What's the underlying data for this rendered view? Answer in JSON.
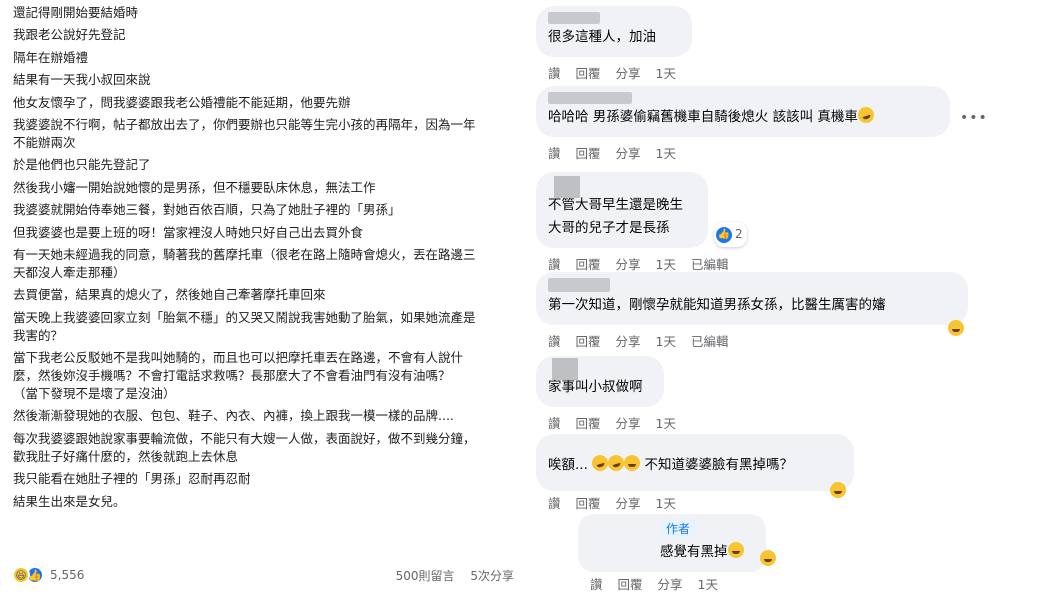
{
  "post": {
    "lines": [
      "還記得剛開始要結婚時",
      "我跟老公說好先登記",
      "隔年在辦婚禮",
      "結果有一天我小叔回來說",
      "他女友懷孕了，問我婆婆跟我老公婚禮能不能延期，他要先辦",
      "我婆婆說不行啊，帖子都放出去了，你們要辦也只能等生完小孩的再隔年，因為一年",
      "不能辦兩次",
      "於是他們也只能先登記了",
      "然後我小嬸一開始說她懷的是男孫，但不穩要臥床休息，無法工作",
      "我婆婆就開始侍奉她三餐，對她百依百順，只為了她肚子裡的「男孫」",
      "但我婆婆也是要上班的呀！當家裡沒人時她只好自己出去買外食",
      "有一天她未經過我的同意，騎著我的舊摩托車（很老在路上隨時會熄火，丟在路邊三",
      "天都沒人牽走那種）",
      "去買便當，結果真的熄火了，然後她自己牽著摩托車回來",
      "當天晚上我婆婆回家立刻「胎氣不穩」的又哭又鬧說我害她動了胎氣，如果她流產是",
      "我害的？",
      "當下我老公反駁她不是我叫她騎的，而且也可以把摩托車丟在路邊，不會有人說什",
      "麼，然後妳沒手機嗎？不會打電話求救嗎？長那麼大了不會看油門有沒有油嗎？",
      "（當下發現不是壞了是沒油）",
      "然後漸漸發現她的衣服、包包、鞋子、內衣、內褲，換上跟我一模一樣的品牌....",
      "每次我婆婆跟她說家事要輪流做，不能只有大嫂一人做，表面說好，做不到幾分鐘，",
      "歡我肚子好痛什麼的，然後就跑上去休息",
      "我只能看在她肚子裡的「男孫」忍耐再忍耐",
      "結果生出來是女兒。"
    ],
    "reaction_count": "5,556",
    "comments_count": "500則留言",
    "shares_count": "5次分享"
  },
  "actions": {
    "like": "讚",
    "reply": "回覆",
    "share": "分享",
    "time": "1天",
    "edited": "已編輯"
  },
  "comments": [
    {
      "text": "很多這種人，加油"
    },
    {
      "text": "哈哈哈 男孫婆偷竊舊機車自騎後熄火 該該叫 真機車"
    },
    {
      "line1": "不管大哥早生還是晚生",
      "line2": "大哥的兒子才是長孫",
      "likes": "2"
    },
    {
      "text": "第一次知道，剛懷孕就能知道男孫女孫，比醫生厲害的嬸"
    },
    {
      "text": "家事叫小叔做啊"
    },
    {
      "prefix": "唉額...",
      "text": "不知道婆婆臉有黑掉嗎？"
    },
    {
      "author_tag": "作者",
      "text": "感覺有黑掉"
    }
  ],
  "colors": {
    "bubble": "#f0f2f5",
    "link_blue": "#1877f2",
    "muted": "#65676b"
  }
}
